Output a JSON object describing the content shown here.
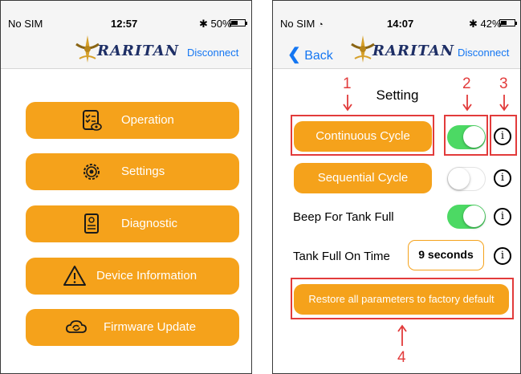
{
  "left_screen": {
    "status": {
      "carrier": "No SIM",
      "time": "12:57",
      "battery": "50%",
      "battery_fill": 0.5
    },
    "logo_text": "RARITAN",
    "disconnect_label": "Disconnect",
    "menu": [
      {
        "label": "Operation",
        "icon": "clipboard-eye-icon"
      },
      {
        "label": "Settings",
        "icon": "gear-icon"
      },
      {
        "label": "Diagnostic",
        "icon": "document-icon"
      },
      {
        "label": "Device Information",
        "icon": "warning-icon"
      },
      {
        "label": "Firmware Update",
        "icon": "cloud-sync-icon"
      }
    ]
  },
  "right_screen": {
    "status": {
      "carrier": "No SIM",
      "time": "14:07",
      "battery": "42%",
      "battery_fill": 0.42
    },
    "back_label": "Back",
    "logo_text": "RARITAN",
    "disconnect_label": "Disconnect",
    "title": "Setting",
    "rows": [
      {
        "label": "Continuous Cycle",
        "toggle_on": true
      },
      {
        "label": "Sequential Cycle",
        "toggle_on": false
      },
      {
        "label": "Beep For Tank Full",
        "toggle_on": true
      },
      {
        "label": "Tank Full On Time",
        "value": "9 seconds"
      }
    ],
    "restore_label": "Restore all parameters to factory default",
    "info_glyph": "i"
  },
  "annotations": {
    "n1": "1",
    "n2": "2",
    "n3": "3",
    "n4": "4"
  },
  "colors": {
    "accent": "#f5a21b",
    "toggle_on": "#4cd964",
    "link": "#1476f2",
    "annotation": "#e23b3b"
  }
}
